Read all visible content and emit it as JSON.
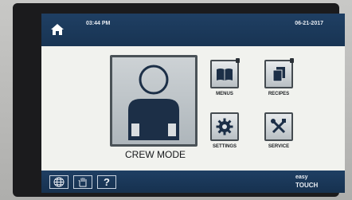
{
  "status_bar": {
    "time": "03:44 PM",
    "date": "06-21-2017",
    "home_icon": "home-icon"
  },
  "main": {
    "crew_mode_label": "CREW MODE",
    "tiles": [
      {
        "label": "MENUS",
        "icon": "book-icon",
        "has_indicator": true
      },
      {
        "label": "RECIPES",
        "icon": "document-stack-icon",
        "has_indicator": true
      },
      {
        "label": "SETTINGS",
        "icon": "gear-icon",
        "has_indicator": false
      },
      {
        "label": "SERVICE",
        "icon": "tools-icon",
        "has_indicator": false
      }
    ]
  },
  "bottom_bar": {
    "buttons": [
      {
        "icon": "globe-icon"
      },
      {
        "icon": "hand-icon"
      },
      {
        "icon": "help-icon",
        "text": "?"
      }
    ],
    "brand_line1": "easy",
    "brand_line2": "TOUCH"
  },
  "colors": {
    "bar": "#1f3f63",
    "screen": "#f1f2ee",
    "icon_dark": "#1c2f47"
  }
}
